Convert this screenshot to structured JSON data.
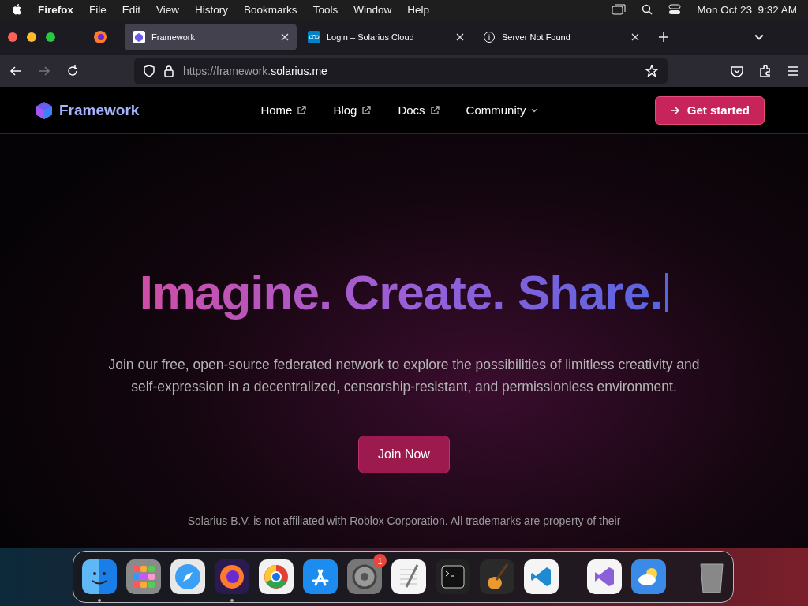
{
  "menubar": {
    "items": [
      "Firefox",
      "File",
      "Edit",
      "View",
      "History",
      "Bookmarks",
      "Tools",
      "Window",
      "Help"
    ],
    "clock": "Mon Oct 23  9:32 AM"
  },
  "tabs": [
    {
      "title": "Framework",
      "selected": true,
      "kind": "cube"
    },
    {
      "title": "Login – Solarius Cloud",
      "selected": false,
      "kind": "cloud"
    },
    {
      "title": "Server Not Found",
      "selected": false,
      "kind": "info"
    }
  ],
  "address": {
    "prefix": "https://framework.",
    "domain": "solarius.me"
  },
  "site": {
    "brand": "Framework",
    "nav": [
      {
        "label": "Home",
        "kind": "external"
      },
      {
        "label": "Blog",
        "kind": "external"
      },
      {
        "label": "Docs",
        "kind": "external"
      },
      {
        "label": "Community",
        "kind": "dropdown"
      }
    ],
    "cta": "Get started",
    "headline": "Imagine. Create. Share.",
    "lead": "Join our free, open-source federated network to explore the possibilities of limitless creativity and self-expression in a decentralized, censorship-resistant, and permissionless environment.",
    "join": "Join Now",
    "footnote": "Solarius B.V. is not affiliated with Roblox Corporation. All trademarks are property of their"
  },
  "dock": [
    {
      "kind": "finder",
      "running": true
    },
    {
      "kind": "launchpad",
      "running": false
    },
    {
      "kind": "safari",
      "running": false
    },
    {
      "kind": "firefox",
      "running": true
    },
    {
      "kind": "chrome",
      "running": false
    },
    {
      "kind": "appstore",
      "running": false
    },
    {
      "kind": "settings",
      "running": false,
      "badge": "1"
    },
    {
      "kind": "textedit",
      "running": false
    },
    {
      "kind": "terminal",
      "running": false
    },
    {
      "kind": "garageband",
      "running": false
    },
    {
      "kind": "vscode",
      "running": false
    },
    {
      "kind": "sep"
    },
    {
      "kind": "visualstudio",
      "running": false
    },
    {
      "kind": "weather",
      "running": false
    },
    {
      "kind": "sep"
    },
    {
      "kind": "trash",
      "running": false
    }
  ]
}
